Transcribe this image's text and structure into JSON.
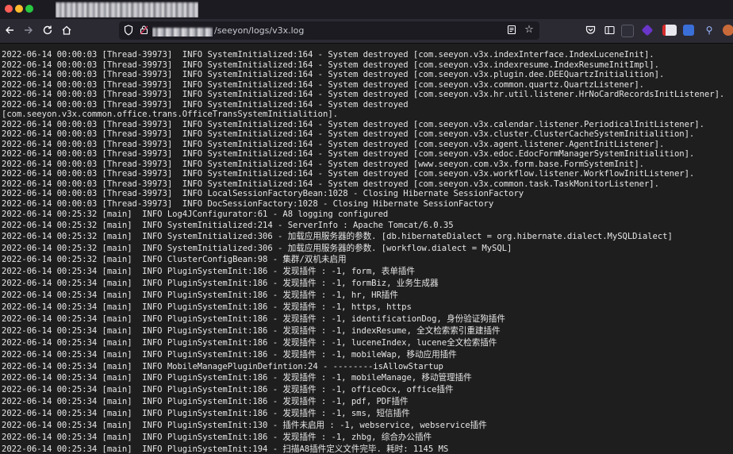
{
  "window": {
    "tab_title": "▇▇▇▇▇▇▇▇▇▇▇▇▇▇▇▇▇▇▇▇▇▇▇▇▇"
  },
  "nav": {
    "back_icon": "arrow-left-icon",
    "forward_icon": "arrow-right-icon",
    "reload_icon": "reload-icon",
    "home_icon": "home-icon"
  },
  "url": {
    "host": "▇▇▇▇▇▇▇▇▇▇▇▇",
    "path": "/seeyon/logs/v3x.log"
  },
  "toolbar": {
    "extensions": [
      "pocket-icon",
      "reader-view-icon",
      "screenshot-icon",
      "extension-purple-icon",
      "extension-red-icon",
      "extension-blue-icon",
      "extension-pin-icon",
      "profile-avatar-icon",
      "settings-gear-icon"
    ]
  },
  "log": [
    "2022-06-14 00:00:03 [Thread-39973]  INFO SystemInitialized:164 - System destroyed [com.seeyon.v3x.indexInterface.IndexLuceneInit].",
    "2022-06-14 00:00:03 [Thread-39973]  INFO SystemInitialized:164 - System destroyed [com.seeyon.v3x.indexresume.IndexResumeInitImpl].",
    "2022-06-14 00:00:03 [Thread-39973]  INFO SystemInitialized:164 - System destroyed [com.seeyon.v3x.plugin.dee.DEEQuartzInitialition].",
    "2022-06-14 00:00:03 [Thread-39973]  INFO SystemInitialized:164 - System destroyed [com.seeyon.v3x.common.quartz.QuartzListener].",
    "2022-06-14 00:00:03 [Thread-39973]  INFO SystemInitialized:164 - System destroyed [com.seeyon.v3x.hr.util.listener.HrNoCardRecordsInitListener].",
    "2022-06-14 00:00:03 [Thread-39973]  INFO SystemInitialized:164 - System destroyed",
    "[com.seeyon.v3x.common.office.trans.OfficeTransSystemInitialition].",
    "2022-06-14 00:00:03 [Thread-39973]  INFO SystemInitialized:164 - System destroyed [com.seeyon.v3x.calendar.listener.PeriodicalInitListener].",
    "2022-06-14 00:00:03 [Thread-39973]  INFO SystemInitialized:164 - System destroyed [com.seeyon.v3x.cluster.ClusterCacheSystemInitialition].",
    "2022-06-14 00:00:03 [Thread-39973]  INFO SystemInitialized:164 - System destroyed [com.seeyon.v3x.agent.listener.AgentInitListener].",
    "2022-06-14 00:00:03 [Thread-39973]  INFO SystemInitialized:164 - System destroyed [com.seeyon.v3x.edoc.EdocFormManagerSystemInitialition].",
    "2022-06-14 00:00:03 [Thread-39973]  INFO SystemInitialized:164 - System destroyed [www.seeyon.com.v3x.form.base.FormSystemInit].",
    "2022-06-14 00:00:03 [Thread-39973]  INFO SystemInitialized:164 - System destroyed [com.seeyon.v3x.workflow.listener.WorkflowInitListener].",
    "2022-06-14 00:00:03 [Thread-39973]  INFO SystemInitialized:164 - System destroyed [com.seeyon.v3x.common.task.TaskMonitorListener].",
    "2022-06-14 00:00:03 [Thread-39973]  INFO LocalSessionFactoryBean:1028 - Closing Hibernate SessionFactory",
    "2022-06-14 00:00:03 [Thread-39973]  INFO DocSessionFactory:1028 - Closing Hibernate SessionFactory",
    "2022-06-14 00:25:32 [main]  INFO Log4JConfigurator:61 - A8 logging configured",
    "2022-06-14 00:25:32 [main]  INFO SystemInitialized:214 - ServerInfo : Apache Tomcat/6.0.35",
    "2022-06-14 00:25:32 [main]  INFO SystemInitialized:306 - 加载应用服务器的参数. [db.hibernateDialect = org.hibernate.dialect.MySQLDialect]",
    "2022-06-14 00:25:32 [main]  INFO SystemInitialized:306 - 加载应用服务器的参数. [workflow.dialect = MySQL]",
    "2022-06-14 00:25:32 [main]  INFO ClusterConfigBean:98 - 集群/双机未启用",
    "2022-06-14 00:25:34 [main]  INFO PluginSystemInit:186 - 发现插件 : -1, form, 表单插件",
    "2022-06-14 00:25:34 [main]  INFO PluginSystemInit:186 - 发现插件 : -1, formBiz, 业务生成器",
    "2022-06-14 00:25:34 [main]  INFO PluginSystemInit:186 - 发现插件 : -1, hr, HR插件",
    "2022-06-14 00:25:34 [main]  INFO PluginSystemInit:186 - 发现插件 : -1, https, https",
    "2022-06-14 00:25:34 [main]  INFO PluginSystemInit:186 - 发现插件 : -1, identificationDog, 身份验证狗插件",
    "2022-06-14 00:25:34 [main]  INFO PluginSystemInit:186 - 发现插件 : -1, indexResume, 全文检索索引重建插件",
    "2022-06-14 00:25:34 [main]  INFO PluginSystemInit:186 - 发现插件 : -1, luceneIndex, lucene全文检索插件",
    "2022-06-14 00:25:34 [main]  INFO PluginSystemInit:186 - 发现插件 : -1, mobileWap, 移动应用插件",
    "2022-06-14 00:25:34 [main]  INFO MobileManagePluginDefintion:24 - --------isAllowStartup",
    "2022-06-14 00:25:34 [main]  INFO PluginSystemInit:186 - 发现插件 : -1, mobileManage, 移动管理插件",
    "2022-06-14 00:25:34 [main]  INFO PluginSystemInit:186 - 发现插件 : -1, officeOcx, office插件",
    "2022-06-14 00:25:34 [main]  INFO PluginSystemInit:186 - 发现插件 : -1, pdf, PDF插件",
    "2022-06-14 00:25:34 [main]  INFO PluginSystemInit:186 - 发现插件 : -1, sms, 短信插件",
    "2022-06-14 00:25:34 [main]  INFO PluginSystemInit:130 - 插件未启用 : -1, webservice, webservice插件",
    "2022-06-14 00:25:34 [main]  INFO PluginSystemInit:186 - 发现插件 : -1, zhbg, 综合办公插件",
    "2022-06-14 00:25:34 [main]  INFO PluginSystemInit:194 - 扫描A8插件定义文件完毕. 耗时: 1145 MS"
  ]
}
